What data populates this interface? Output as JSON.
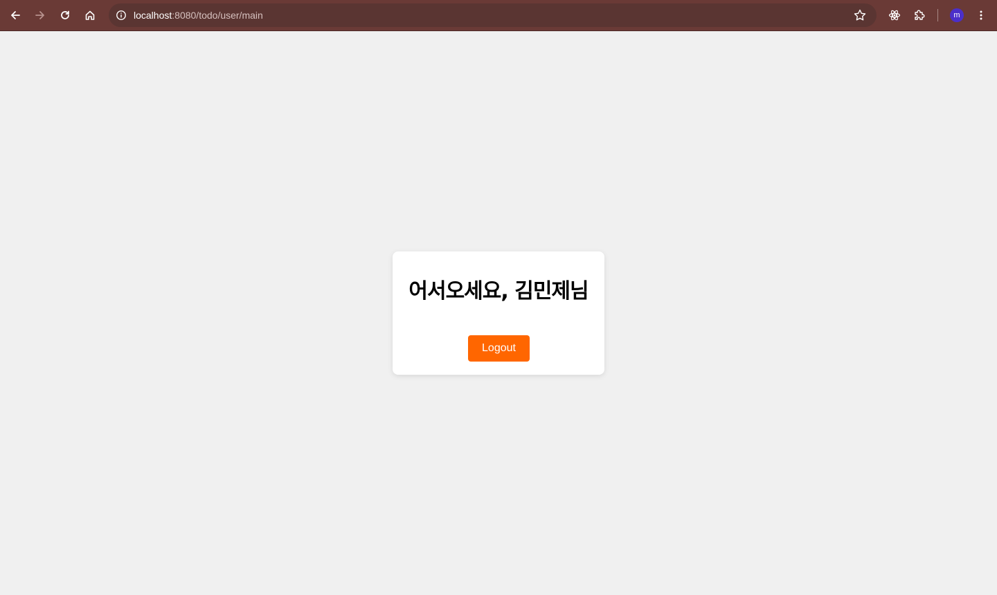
{
  "browser": {
    "url_host": "localhost",
    "url_path": ":8080/todo/user/main",
    "profile_initial": "m",
    "icons": {
      "back": "arrow-left-icon",
      "forward": "arrow-right-icon",
      "reload": "reload-icon",
      "home": "home-icon",
      "site_info": "info-icon",
      "bookmark": "star-icon",
      "react_devtools": "react-icon",
      "extensions": "puzzle-icon",
      "menu": "kebab-menu-icon"
    },
    "colors": {
      "toolbar": "#6a3a36",
      "omnibox": "#5a3532",
      "avatar": "#4b2fc9"
    }
  },
  "page": {
    "welcome_text": "어서오세요, 김민제님",
    "logout_label": "Logout",
    "colors": {
      "background": "#f0f0f0",
      "card": "#ffffff",
      "button": "#ff6600"
    }
  }
}
